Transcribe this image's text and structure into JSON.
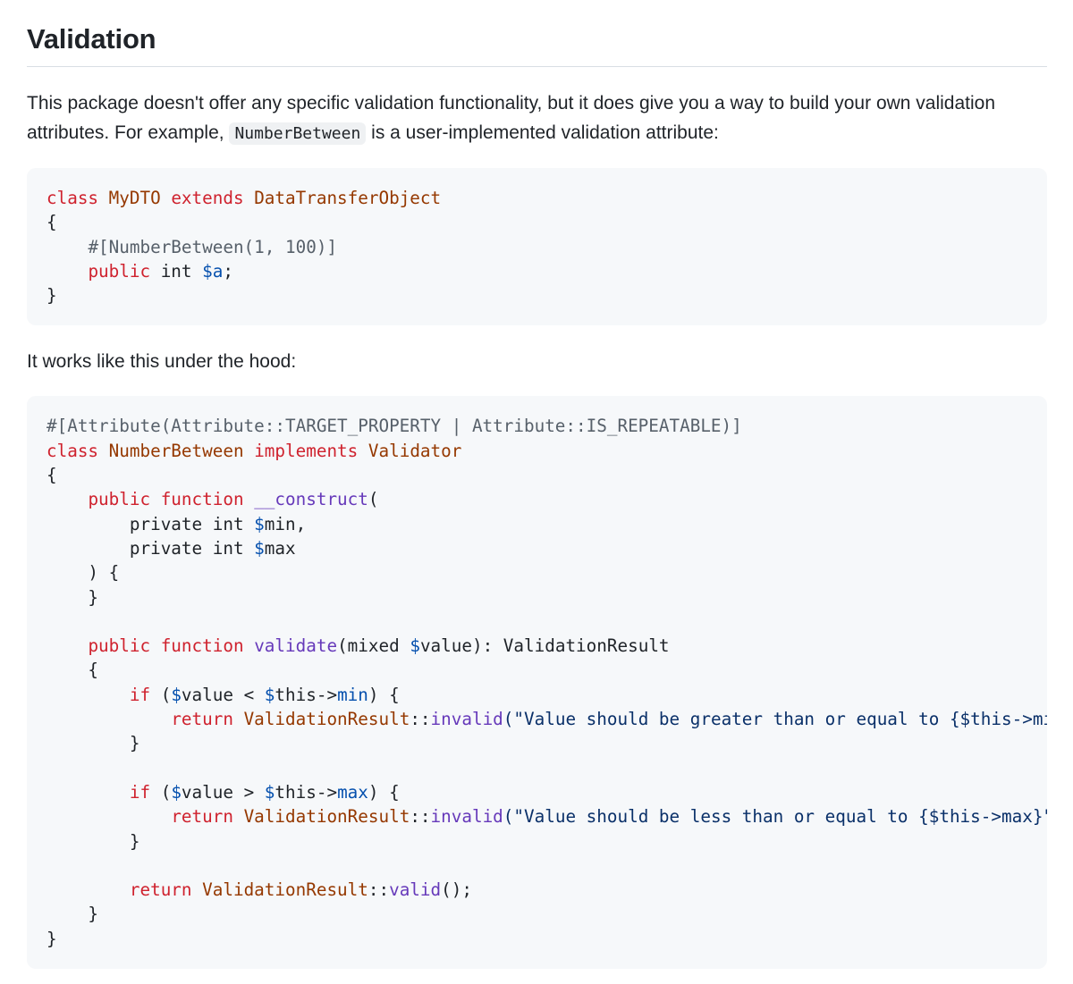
{
  "heading": "Validation",
  "intro": {
    "before": "This package doesn't offer any specific validation functionality, but it does give you a way to build your own validation attributes. For example, ",
    "code": "NumberBetween",
    "after": " is a user-implemented validation attribute:"
  },
  "middle_text": "It works like this under the hood:",
  "code_example_1": [
    [
      [
        "k",
        "class"
      ],
      [
        "p",
        " "
      ],
      [
        "c",
        "MyDTO"
      ],
      [
        "p",
        " "
      ],
      [
        "k",
        "extends"
      ],
      [
        "p",
        " "
      ],
      [
        "c",
        "DataTransferObject"
      ]
    ],
    [
      [
        "p",
        "{"
      ]
    ],
    [
      [
        "p",
        "    "
      ],
      [
        "a",
        "#[NumberBetween(1, 100)]"
      ]
    ],
    [
      [
        "p",
        "    "
      ],
      [
        "k",
        "public"
      ],
      [
        "p",
        " int "
      ],
      [
        "v",
        "$a"
      ],
      [
        "p",
        ";"
      ]
    ],
    [
      [
        "p",
        "}"
      ]
    ]
  ],
  "code_example_2": [
    [
      [
        "a",
        "#[Attribute(Attribute::TARGET_PROPERTY | Attribute::IS_REPEATABLE)]"
      ]
    ],
    [
      [
        "k",
        "class"
      ],
      [
        "p",
        " "
      ],
      [
        "c",
        "NumberBetween"
      ],
      [
        "p",
        " "
      ],
      [
        "k",
        "implements"
      ],
      [
        "p",
        " "
      ],
      [
        "c",
        "Validator"
      ]
    ],
    [
      [
        "p",
        "{"
      ]
    ],
    [
      [
        "p",
        "    "
      ],
      [
        "k",
        "public"
      ],
      [
        "p",
        " "
      ],
      [
        "k",
        "function"
      ],
      [
        "p",
        " "
      ],
      [
        "f",
        "__construct"
      ],
      [
        "p",
        "("
      ]
    ],
    [
      [
        "p",
        "        private int "
      ],
      [
        "v",
        "$"
      ],
      [
        "p",
        "min,"
      ]
    ],
    [
      [
        "p",
        "        private int "
      ],
      [
        "v",
        "$"
      ],
      [
        "p",
        "max"
      ]
    ],
    [
      [
        "p",
        "    ) {"
      ]
    ],
    [
      [
        "p",
        "    }"
      ]
    ],
    [],
    [
      [
        "p",
        "    "
      ],
      [
        "k",
        "public"
      ],
      [
        "p",
        " "
      ],
      [
        "k",
        "function"
      ],
      [
        "p",
        " "
      ],
      [
        "f",
        "validate"
      ],
      [
        "p",
        "(mixed "
      ],
      [
        "v",
        "$"
      ],
      [
        "p",
        "value): ValidationResult"
      ]
    ],
    [
      [
        "p",
        "    {"
      ]
    ],
    [
      [
        "p",
        "        "
      ],
      [
        "k",
        "if"
      ],
      [
        "p",
        " ("
      ],
      [
        "v",
        "$"
      ],
      [
        "p",
        "value < "
      ],
      [
        "v",
        "$"
      ],
      [
        "p",
        "this->"
      ],
      [
        "v",
        "min"
      ],
      [
        "p",
        ") {"
      ]
    ],
    [
      [
        "p",
        "            "
      ],
      [
        "k",
        "return"
      ],
      [
        "p",
        " "
      ],
      [
        "c",
        "ValidationResult"
      ],
      [
        "p",
        "::"
      ],
      [
        "f",
        "invalid"
      ],
      [
        "s",
        "(\"Value should be greater than or equal to {$this->min}\");"
      ]
    ],
    [
      [
        "p",
        "        }"
      ]
    ],
    [],
    [
      [
        "p",
        "        "
      ],
      [
        "k",
        "if"
      ],
      [
        "p",
        " ("
      ],
      [
        "v",
        "$"
      ],
      [
        "p",
        "value > "
      ],
      [
        "v",
        "$"
      ],
      [
        "p",
        "this->"
      ],
      [
        "v",
        "max"
      ],
      [
        "p",
        ") {"
      ]
    ],
    [
      [
        "p",
        "            "
      ],
      [
        "k",
        "return"
      ],
      [
        "p",
        " "
      ],
      [
        "c",
        "ValidationResult"
      ],
      [
        "p",
        "::"
      ],
      [
        "f",
        "invalid"
      ],
      [
        "s",
        "(\"Value should be less than or equal to {$this->max}\");"
      ]
    ],
    [
      [
        "p",
        "        }"
      ]
    ],
    [],
    [
      [
        "p",
        "        "
      ],
      [
        "k",
        "return"
      ],
      [
        "p",
        " "
      ],
      [
        "c",
        "ValidationResult"
      ],
      [
        "p",
        "::"
      ],
      [
        "f",
        "valid"
      ],
      [
        "p",
        "();"
      ]
    ],
    [
      [
        "p",
        "    }"
      ]
    ],
    [
      [
        "p",
        "}"
      ]
    ]
  ]
}
